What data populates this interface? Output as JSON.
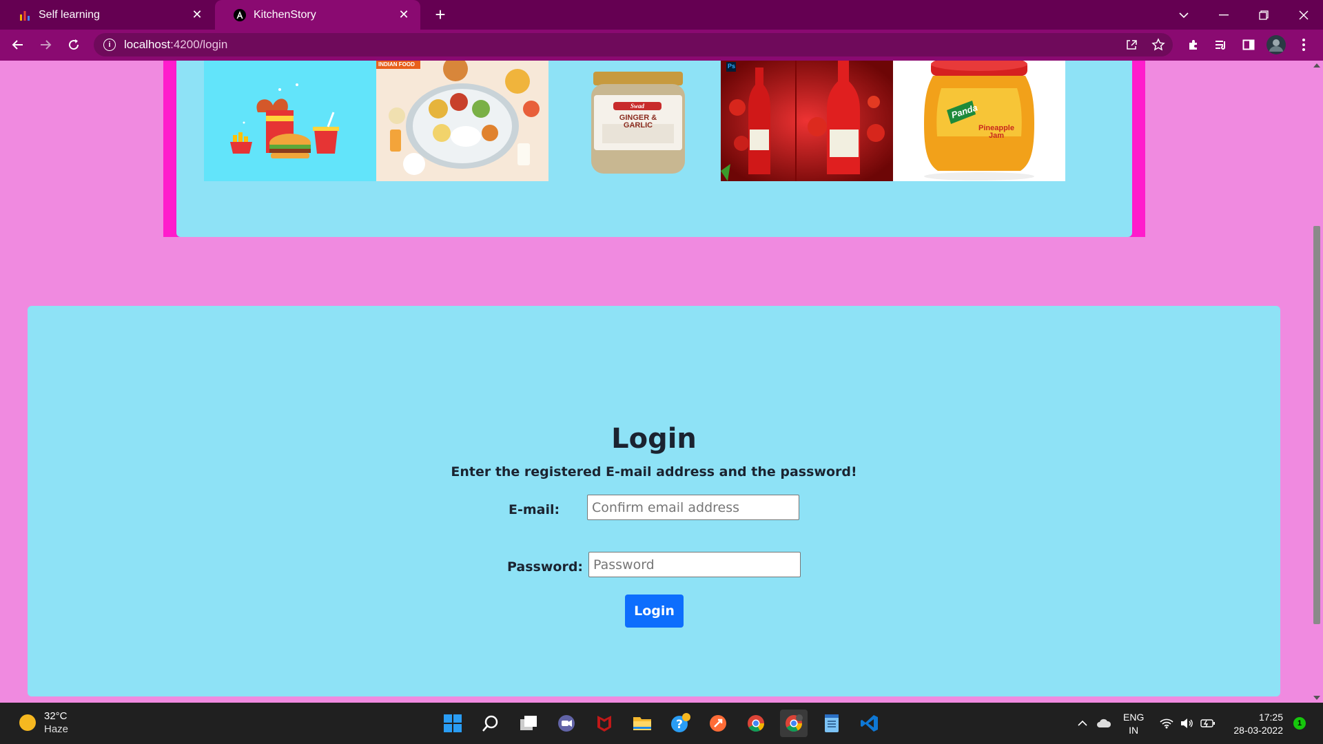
{
  "browser": {
    "tabs": [
      {
        "title": "Self learning",
        "favicon": "bar-chart-icon"
      },
      {
        "title": "KitchenStory",
        "favicon": "angular-icon"
      }
    ],
    "url_host": "localhost",
    "url_path": ":4200/login"
  },
  "carousel": {
    "slides": [
      {
        "name": "fast-food-illustration",
        "badge": ""
      },
      {
        "name": "indian-thali",
        "badge": "INDIAN FOOD"
      },
      {
        "name": "ginger-garlic-jar",
        "label": "GINGER & GARLIC",
        "brand": "Swad"
      },
      {
        "name": "heinz-ketchup",
        "badge": "Ps"
      },
      {
        "name": "pineapple-jam-jar",
        "brand": "Panda",
        "label": "Pineapple Jam"
      }
    ]
  },
  "login": {
    "title": "Login",
    "subtitle": "Enter the registered E-mail address and the password!",
    "email_label": "E-mail:",
    "email_placeholder": "Confirm email address",
    "password_label": "Password:",
    "password_placeholder": "Password",
    "button_label": "Login"
  },
  "taskbar": {
    "weather_temp": "32°C",
    "weather_condition": "Haze",
    "lang_line1": "ENG",
    "lang_line2": "IN",
    "time": "17:25",
    "date": "28-03-2022",
    "notification_count": "1"
  },
  "colors": {
    "page_bg": "#f08ae0",
    "card_bg": "#8ee2f6",
    "carousel_border": "#ff1ccc",
    "button_primary": "#0d6efd",
    "chrome_tabbar": "#650052",
    "chrome_toolbar": "#8a0a71"
  }
}
